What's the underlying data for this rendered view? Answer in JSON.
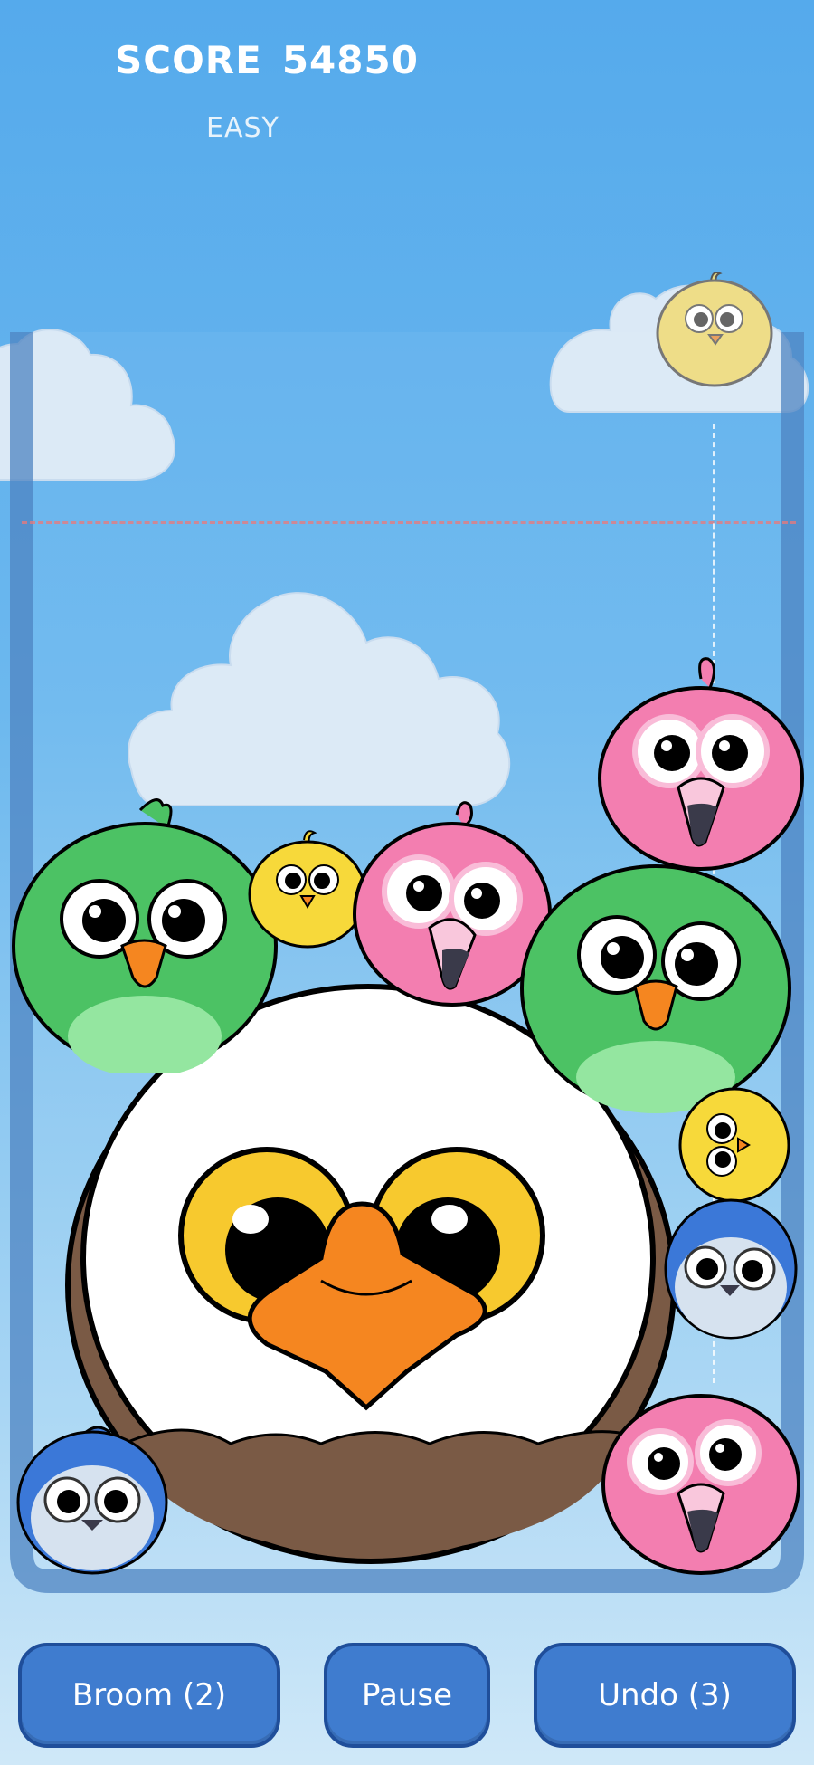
{
  "hud": {
    "score_label": "SCORE",
    "score_value": "54850",
    "difficulty": "EASY"
  },
  "buttons": {
    "broom": "Broom (2)",
    "pause": "Pause",
    "undo": "Undo (3)"
  },
  "colors": {
    "sky": "#55aaec",
    "button_fill": "#3f7ccf",
    "button_border": "#1f4e9a",
    "danger_line": "#ec7878"
  },
  "next_bird": "yellow-chick",
  "birds_in_play": [
    "bald-eagle",
    "parrot",
    "parrot",
    "flamingo",
    "flamingo",
    "flamingo",
    "chick",
    "chick",
    "blue-jay",
    "blue-jay"
  ]
}
